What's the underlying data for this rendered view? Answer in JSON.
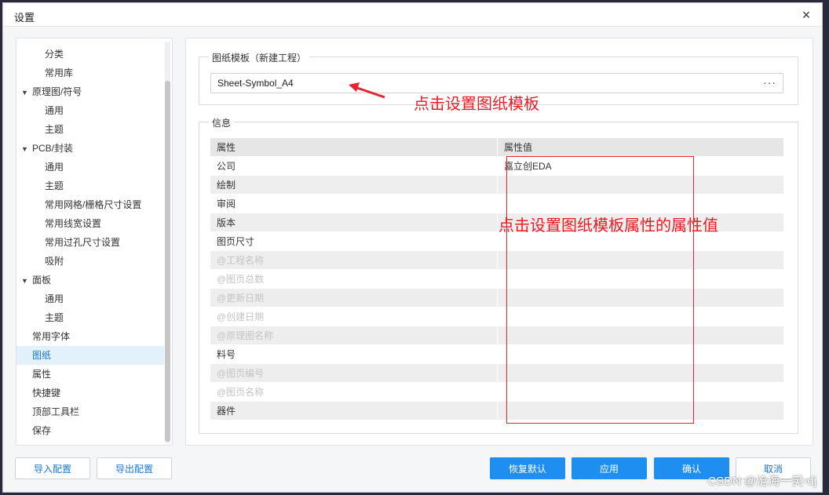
{
  "dialog": {
    "title": "设置",
    "close_glyph": "×"
  },
  "nav": {
    "items": [
      {
        "label": "分类",
        "level": 2
      },
      {
        "label": "常用库",
        "level": 2
      },
      {
        "label": "原理图/符号",
        "level": 1,
        "caret": "▼"
      },
      {
        "label": "通用",
        "level": 2
      },
      {
        "label": "主题",
        "level": 2
      },
      {
        "label": "PCB/封装",
        "level": 1,
        "caret": "▼"
      },
      {
        "label": "通用",
        "level": 2
      },
      {
        "label": "主题",
        "level": 2
      },
      {
        "label": "常用网格/栅格尺寸设置",
        "level": 2
      },
      {
        "label": "常用线宽设置",
        "level": 2
      },
      {
        "label": "常用过孔尺寸设置",
        "level": 2
      },
      {
        "label": "吸附",
        "level": 2
      },
      {
        "label": "面板",
        "level": 1,
        "caret": "▼"
      },
      {
        "label": "通用",
        "level": 2
      },
      {
        "label": "主题",
        "level": 2
      },
      {
        "label": "常用字体",
        "level": 1
      },
      {
        "label": "图纸",
        "level": 1,
        "active": true
      },
      {
        "label": "属性",
        "level": 1
      },
      {
        "label": "快捷键",
        "level": 1
      },
      {
        "label": "顶部工具栏",
        "level": 1
      },
      {
        "label": "保存",
        "level": 1
      }
    ]
  },
  "template_group": {
    "legend": "图纸模板（新建工程）",
    "value": "Sheet-Symbol_A4",
    "more_glyph": "···"
  },
  "info_group": {
    "legend": "信息",
    "headers": {
      "key": "属性",
      "value": "属性值"
    },
    "rows": [
      {
        "key": "公司",
        "value": "嘉立创EDA",
        "muted": false
      },
      {
        "key": "绘制",
        "value": "",
        "muted": false
      },
      {
        "key": "审阅",
        "value": "",
        "muted": false
      },
      {
        "key": "版本",
        "value": "",
        "muted": false
      },
      {
        "key": "图页尺寸",
        "value": "",
        "muted": false
      },
      {
        "key": "@工程名称",
        "value": "",
        "muted": true
      },
      {
        "key": "@图页总数",
        "value": "",
        "muted": true
      },
      {
        "key": "@更新日期",
        "value": "",
        "muted": true
      },
      {
        "key": "@创建日期",
        "value": "",
        "muted": true
      },
      {
        "key": "@原理图名称",
        "value": "",
        "muted": true
      },
      {
        "key": "料号",
        "value": "",
        "muted": false
      },
      {
        "key": "@图页编号",
        "value": "",
        "muted": true
      },
      {
        "key": "@图页名称",
        "value": "",
        "muted": true
      },
      {
        "key": "器件",
        "value": "",
        "muted": false
      }
    ]
  },
  "buttons": {
    "import": "导入配置",
    "export": "导出配置",
    "restore": "恢复默认",
    "apply": "应用",
    "ok": "确认",
    "cancel": "取消"
  },
  "annotations": {
    "template_hint": "点击设置图纸模板",
    "value_hint": "点击设置图纸模板属性的属性值",
    "color": "#e81c24"
  },
  "watermark": "CSDN @沧海一笑-dj"
}
